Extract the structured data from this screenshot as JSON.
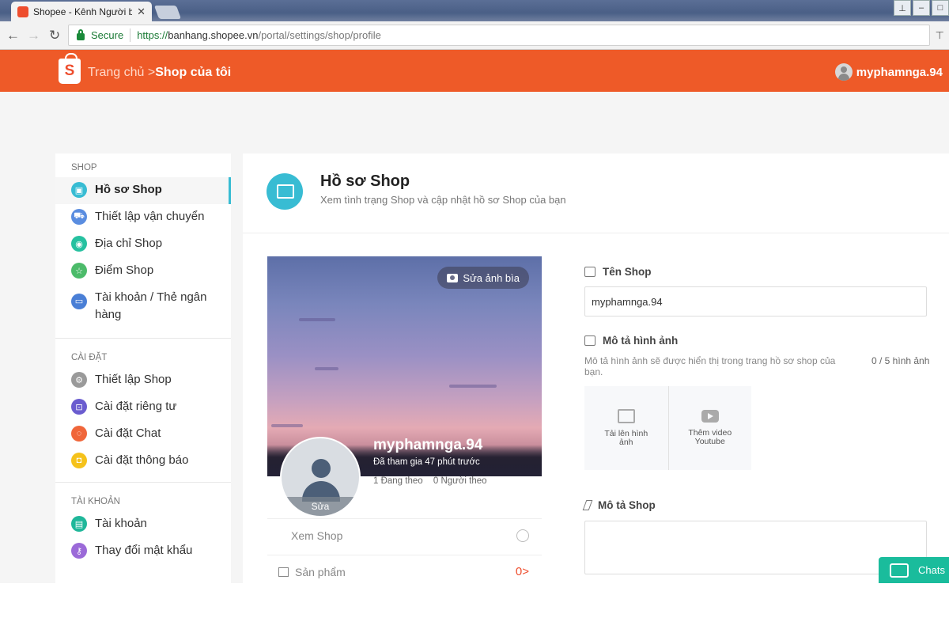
{
  "browser": {
    "tab_title": "Shopee - Kênh Người bá",
    "tab_close": "✕",
    "secure_label": "Secure",
    "url_scheme": "https://",
    "url_host": "banhang.shopee.vn",
    "url_path": "/portal/settings/shop/profile"
  },
  "header": {
    "logo_letter": "S",
    "crumb_home": "Trang chủ",
    "crumb_sep": " >",
    "crumb_current": "Shop của tôi",
    "username": "myphamnga.94",
    "brand_color": "#ee5a28"
  },
  "sidebar": {
    "sections": [
      {
        "title": "SHOP"
      },
      {
        "title": "CÀI ĐẶT"
      },
      {
        "title": "TÀI KHOẢN"
      }
    ],
    "items": [
      {
        "label": "Hồ sơ Shop",
        "icon": "profile-icon",
        "color": "#38bcd3"
      },
      {
        "label": "Thiết lập vận chuyển",
        "icon": "truck-icon",
        "color": "#5a8de0"
      },
      {
        "label": "Địa chỉ Shop",
        "icon": "location-icon",
        "color": "#26c1a0"
      },
      {
        "label": "Điểm Shop",
        "icon": "star-icon",
        "color": "#4cbb6a"
      },
      {
        "label": "Tài khoản / Thẻ ngân hàng",
        "icon": "card-icon",
        "color": "#4a7fd6"
      },
      {
        "label": "Thiết lập Shop",
        "icon": "gear-icon",
        "color": "#9a9a9a"
      },
      {
        "label": "Cài đặt riêng tư",
        "icon": "lock-icon",
        "color": "#6a5ccf"
      },
      {
        "label": "Cài đặt Chat",
        "icon": "chat-icon",
        "color": "#f0663a"
      },
      {
        "label": "Cài đặt thông báo",
        "icon": "bell-icon",
        "color": "#f5c21b"
      },
      {
        "label": "Tài khoản",
        "icon": "id-card-icon",
        "color": "#1fb79a"
      },
      {
        "label": "Thay đổi mật khẩu",
        "icon": "key-icon",
        "color": "#9b6ad8"
      }
    ]
  },
  "page": {
    "title": "Hồ sơ Shop",
    "subtitle": "Xem tình trạng Shop và cập nhật hồ sơ Shop của bạn"
  },
  "cover": {
    "edit_cover_label": "Sửa ảnh bìa",
    "shop_name": "myphamnga.94",
    "joined": "Đã tham gia 47 phút trước",
    "following": "1 Đang theo",
    "followers": "0 Người theo",
    "avatar_edit": "Sửa",
    "view_shop": "Xem Shop",
    "products_label": "Sản phẩm",
    "products_count": "0",
    "products_chevron": ">"
  },
  "form": {
    "shop_name_label": "Tên Shop",
    "shop_name_value": "myphamnga.94",
    "image_desc_label": "Mô tả hình ảnh",
    "image_desc_help": "Mô tả hình ảnh sẽ được hiển thị trong trang hồ sơ shop của bạn.",
    "image_count": "0 / 5 hình ảnh",
    "upload_image": "Tải lên hình ảnh",
    "add_video": "Thêm video Youtube",
    "shop_desc_label": "Mô tả Shop"
  },
  "chat": {
    "label": "Chats"
  }
}
